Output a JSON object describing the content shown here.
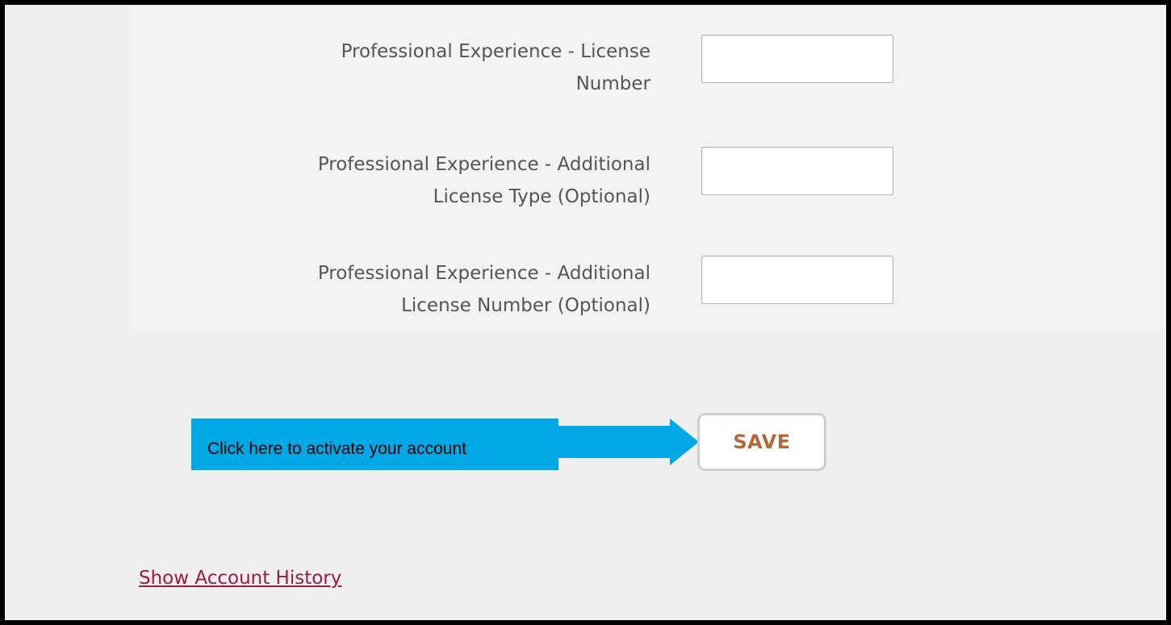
{
  "form": {
    "fields": [
      {
        "label": "Professional Experience - License\nNumber",
        "value": ""
      },
      {
        "label": "Professional Experience - Additional\nLicense Type (Optional)",
        "value": ""
      },
      {
        "label": "Professional Experience - Additional\nLicense Number (Optional)",
        "value": ""
      }
    ],
    "save_label": "SAVE",
    "save_color": "#b36a3a"
  },
  "callout": {
    "text": "Click here to activate your account",
    "color": "#00a9e6",
    "icon": "arrow-right-icon"
  },
  "footer": {
    "history_link": "Show Account History",
    "link_color": "#9a1c3e"
  }
}
